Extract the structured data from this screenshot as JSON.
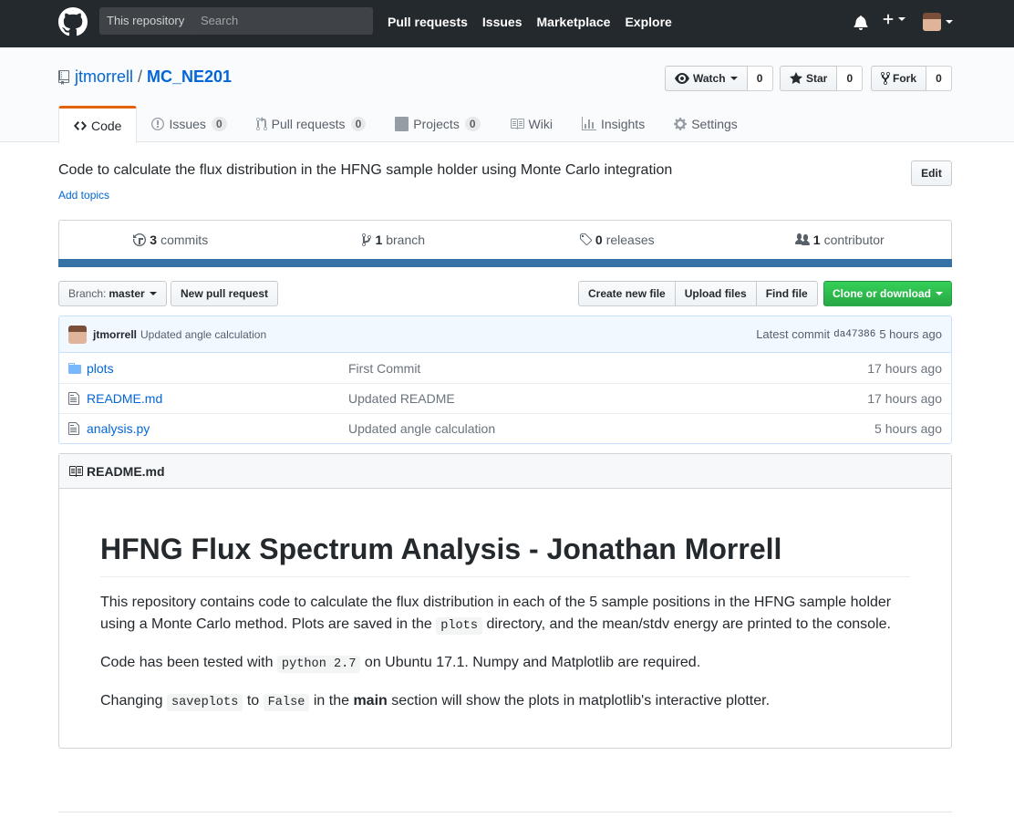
{
  "header": {
    "search_scope": "This repository",
    "search_placeholder": "Search",
    "nav": [
      "Pull requests",
      "Issues",
      "Marketplace",
      "Explore"
    ]
  },
  "repo": {
    "owner": "jtmorrell",
    "separator": "/",
    "name": "MC_NE201",
    "watch_label": "Watch",
    "watch_count": "0",
    "star_label": "Star",
    "star_count": "0",
    "fork_label": "Fork",
    "fork_count": "0"
  },
  "tabs": [
    {
      "label": "Code",
      "icon": "code-icon"
    },
    {
      "label": "Issues",
      "count": "0",
      "icon": "issue-icon"
    },
    {
      "label": "Pull requests",
      "count": "0",
      "icon": "pull-request-icon"
    },
    {
      "label": "Projects",
      "count": "0",
      "icon": "project-icon"
    },
    {
      "label": "Wiki",
      "icon": "book-icon"
    },
    {
      "label": "Insights",
      "icon": "graph-icon"
    },
    {
      "label": "Settings",
      "icon": "gear-icon"
    }
  ],
  "description": "Code to calculate the flux distribution in the HFNG sample holder using Monte Carlo integration",
  "add_topics": "Add topics",
  "edit_label": "Edit",
  "summary": {
    "commits_count": "3",
    "commits_label": "commits",
    "branch_count": "1",
    "branch_label": "branch",
    "releases_count": "0",
    "releases_label": "releases",
    "contributor_count": "1",
    "contributor_label": "contributor",
    "language_bar_color": "#3572A5"
  },
  "file_nav": {
    "branch_label": "Branch:",
    "branch_name": "master",
    "new_pull_request": "New pull request",
    "create_new_file": "Create new file",
    "upload_files": "Upload files",
    "find_file": "Find file",
    "clone_or_download": "Clone or download"
  },
  "latest_commit": {
    "author": "jtmorrell",
    "message": "Updated angle calculation",
    "prefix": "Latest commit",
    "sha": "da47386",
    "age": "5 hours ago"
  },
  "files": [
    {
      "name": "plots",
      "type": "directory",
      "message": "First Commit",
      "age": "17 hours ago"
    },
    {
      "name": "README.md",
      "type": "file",
      "message": "Updated README",
      "age": "17 hours ago"
    },
    {
      "name": "analysis.py",
      "type": "file",
      "message": "Updated angle calculation",
      "age": "5 hours ago"
    }
  ],
  "readme": {
    "filename": "README.md",
    "title": "HFNG Flux Spectrum Analysis - Jonathan Morrell",
    "p1_a": "This repository contains code to calculate the flux distribution in each of the 5 sample positions in the HFNG sample holder using a Monte Carlo method. Plots are saved in the ",
    "p1_code": "plots",
    "p1_b": " directory, and the mean/stdv energy are printed to the console.",
    "p2_a": "Code has been tested with ",
    "p2_code": "python 2.7",
    "p2_b": " on Ubuntu 17.1. Numpy and Matplotlib are required.",
    "p3_a": "Changing ",
    "p3_code1": "saveplots",
    "p3_mid": " to ",
    "p3_code2": "False",
    "p3_c": " in the ",
    "p3_bold": "main",
    "p3_d": " section will show the plots in matplotlib's interactive plotter."
  }
}
